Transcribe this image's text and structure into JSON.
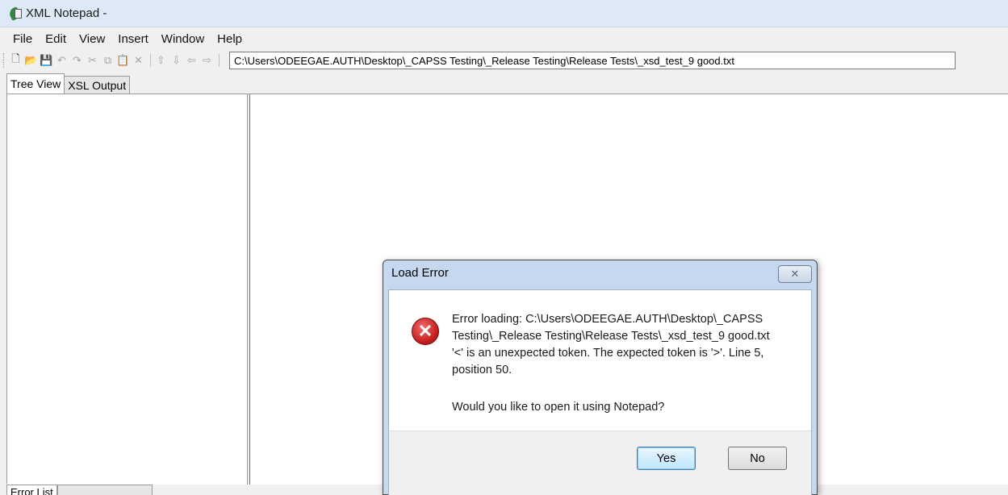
{
  "window": {
    "title": "XML Notepad -",
    "icon": "xml-notepad-icon"
  },
  "menu": [
    "File",
    "Edit",
    "View",
    "Insert",
    "Window",
    "Help"
  ],
  "toolbar": {
    "buttons": [
      {
        "icon": "new-icon",
        "glyph": "🗋"
      },
      {
        "icon": "open-icon",
        "glyph": "📂"
      },
      {
        "icon": "save-icon",
        "glyph": "💾"
      },
      {
        "icon": "undo-icon",
        "glyph": "↶"
      },
      {
        "icon": "redo-icon",
        "glyph": "↷"
      },
      {
        "icon": "cut-icon",
        "glyph": "✂"
      },
      {
        "icon": "copy-icon",
        "glyph": "⧉"
      },
      {
        "icon": "paste-icon",
        "glyph": "📋"
      },
      {
        "icon": "delete-icon",
        "glyph": "✕"
      },
      {
        "icon": "nudge-up-icon",
        "glyph": "⇧"
      },
      {
        "icon": "nudge-down-icon",
        "glyph": "⇩"
      },
      {
        "icon": "nudge-left-icon",
        "glyph": "⇦"
      },
      {
        "icon": "nudge-right-icon",
        "glyph": "⇨"
      }
    ],
    "file_path": "C:\\Users\\ODEEGAE.AUTH\\Desktop\\_CAPSS Testing\\_Release Testing\\Release Tests\\_xsd_test_9 good.txt"
  },
  "tabs": {
    "tree_view": "Tree View",
    "xsl_output": "XSL Output"
  },
  "bottom_tabs": {
    "error_list": "Error List",
    "dynamic_help": ""
  },
  "dialog": {
    "title": "Load Error",
    "close_glyph": "✕",
    "icon": "error-icon",
    "message_lines": [
      "Error loading: C:\\Users\\ODEEGAE.AUTH\\Desktop\\_CAPSS",
      "Testing\\_Release Testing\\Release Tests\\_xsd_test_9 good.txt",
      "'<' is an unexpected token. The expected token is '>'. Line 5,",
      "position 50."
    ],
    "question": "Would you like to open it using Notepad?",
    "yes_label": "Yes",
    "no_label": "No"
  }
}
